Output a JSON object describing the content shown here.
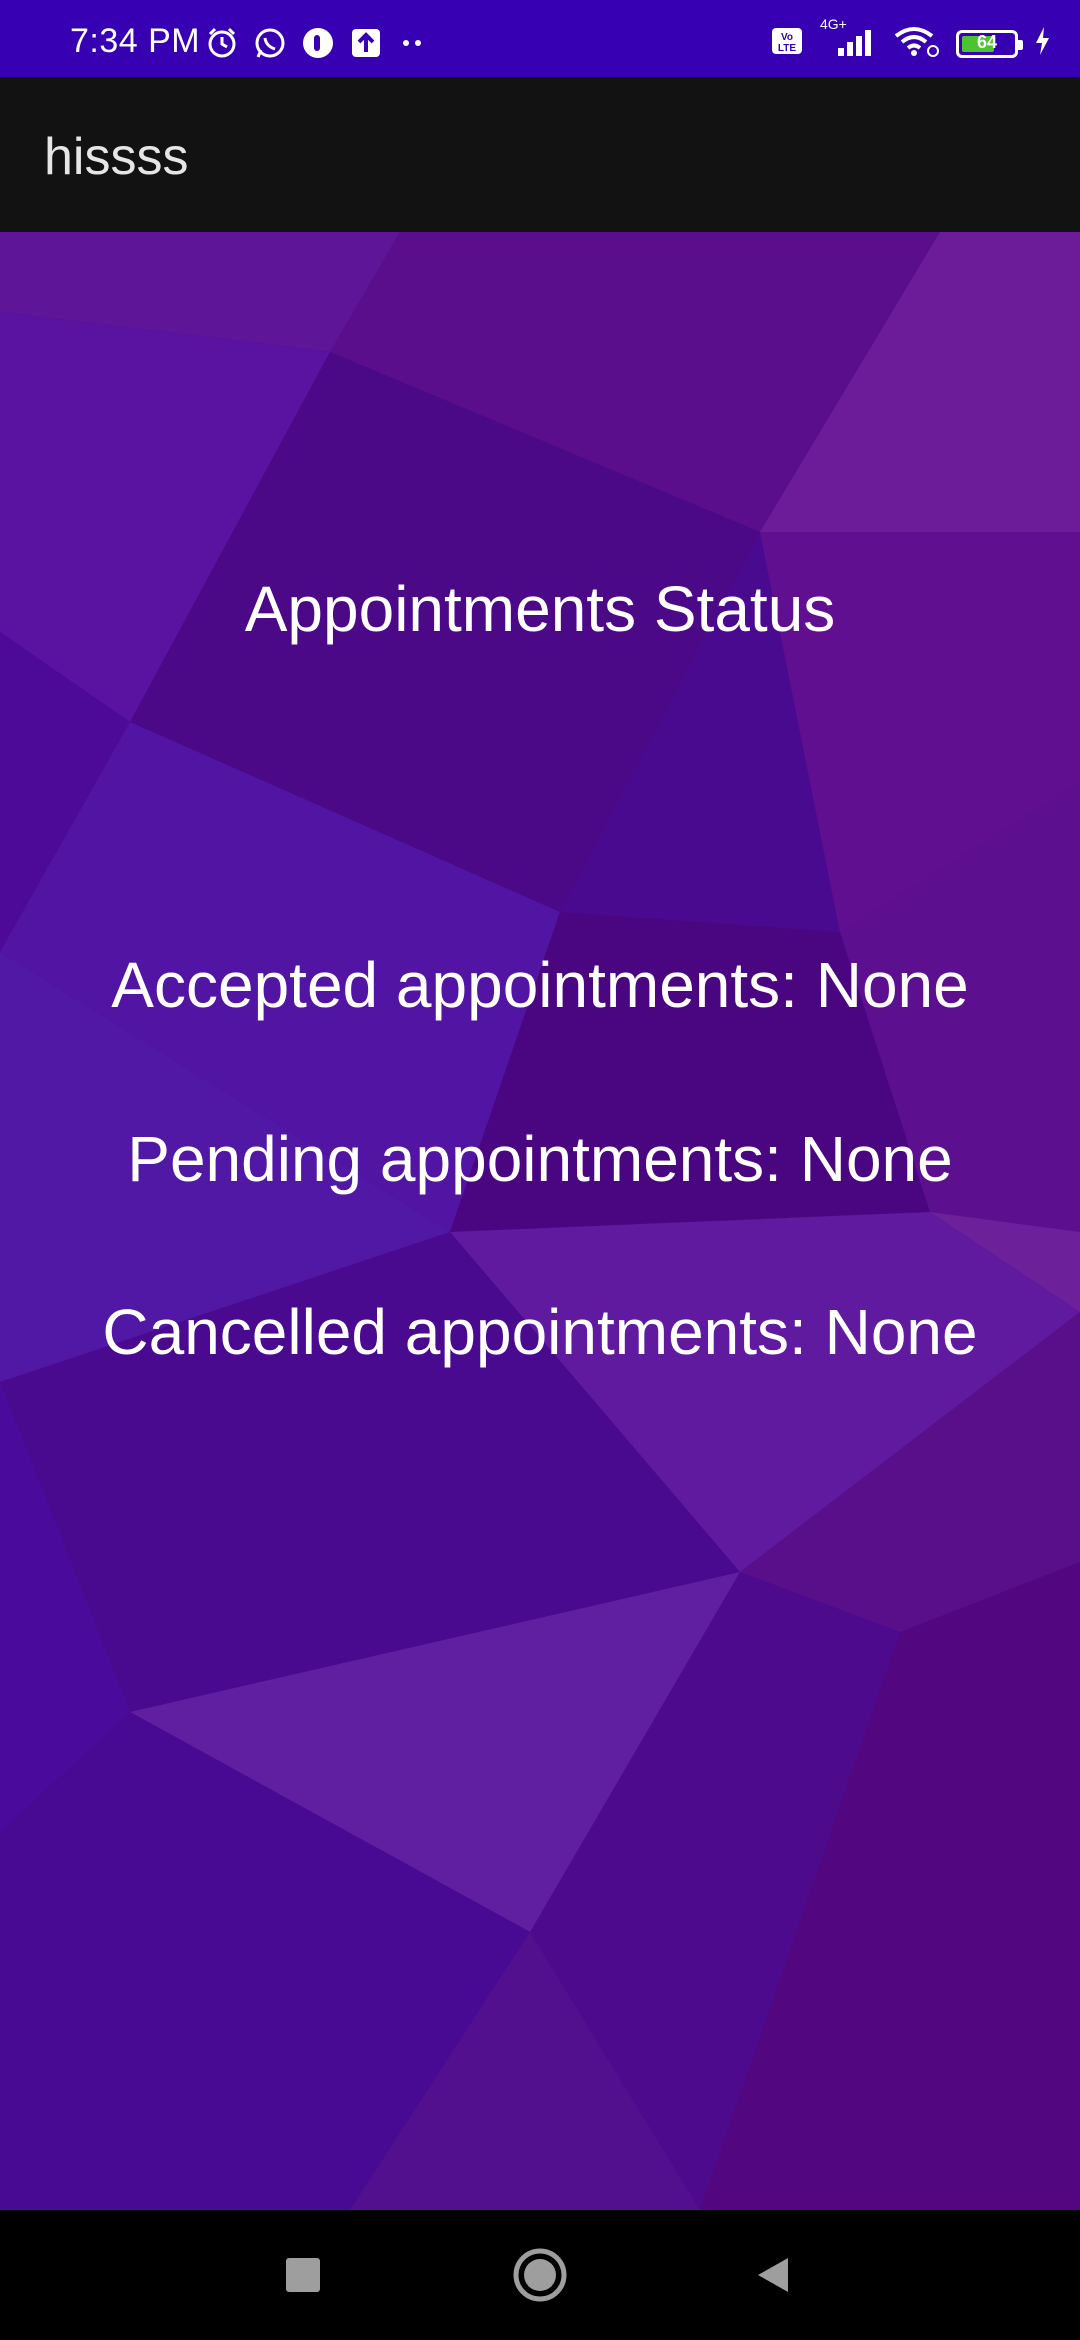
{
  "status_bar": {
    "time": "7:34 PM",
    "battery_level": "64",
    "battery_fraction": 0.64,
    "network_label": "4G+",
    "icons_left": [
      "alarm-icon",
      "whatsapp-icon",
      "app-notification-icon",
      "upload-icon",
      "more-dots-icon"
    ],
    "icons_right": [
      "volte-icon",
      "signal-icon",
      "wifi-icon",
      "battery-icon",
      "charging-icon"
    ]
  },
  "app_bar": {
    "title": "hissss"
  },
  "main": {
    "heading": "Appointments Status",
    "accepted": "Accepted appointments: None",
    "pending": "Pending appointments: None",
    "cancelled": "Cancelled appointments: None"
  },
  "nav_bar": {
    "icons": [
      "recents-square-icon",
      "home-circle-icon",
      "back-triangle-icon"
    ]
  },
  "colors": {
    "status_bar_bg": "#3700b3",
    "app_bar_bg": "#121212",
    "content_bg_primary": "#4a0a8f",
    "content_bg_accent": "#6a1b9a",
    "battery_fill": "#4cc430"
  }
}
